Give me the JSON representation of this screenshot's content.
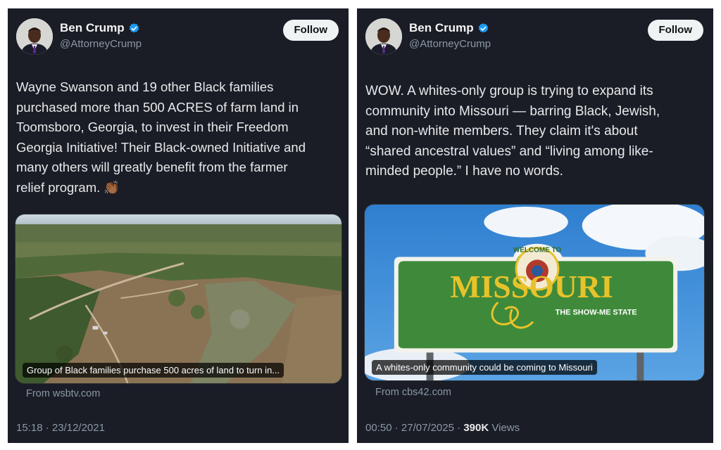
{
  "tweets": [
    {
      "author": {
        "name": "Ben Crump",
        "handle": "@AttorneyCrump"
      },
      "follow_label": "Follow",
      "text": "Wayne Swanson and 19 other Black families\npurchased more than 500 ACRES of farm land in\nToomsboro, Georgia, to invest in their Freedom\nGeorgia Initiative! Their Black-owned Initiative and\nmany others will greatly benefit from the farmer\nrelief program. 👏🏾",
      "media_caption": "Group of Black families purchase 500 acres of land to turn in...",
      "source": "From wsbtv.com",
      "time": "15:18",
      "date": "23/12/2021"
    },
    {
      "author": {
        "name": "Ben Crump",
        "handle": "@AttorneyCrump"
      },
      "follow_label": "Follow",
      "text": "WOW. A whites-only group is trying to expand its\ncommunity into Missouri — barring Black, Jewish,\nand non-white members. They claim it's about\n“shared ancestral values” and “living among like-\nminded people.” I have no words.",
      "media_caption": "A whites-only community could be coming to Missouri",
      "sign": {
        "top_text": "WELCOME TO",
        "main_text": "MISSOURI",
        "sub_text": "THE SHOW-ME STATE"
      },
      "source": "From cbs42.com",
      "time": "00:50",
      "date": "27/07/2025",
      "views_count": "390K",
      "views_label": "Views"
    }
  ],
  "colors": {
    "card_bg": "#1a1d26",
    "verified_blue": "#1d9bf0",
    "sign_green": "#3e8a3a",
    "sign_gold": "#e8c22a"
  },
  "icons": {
    "verified": "verified-badge-icon"
  }
}
